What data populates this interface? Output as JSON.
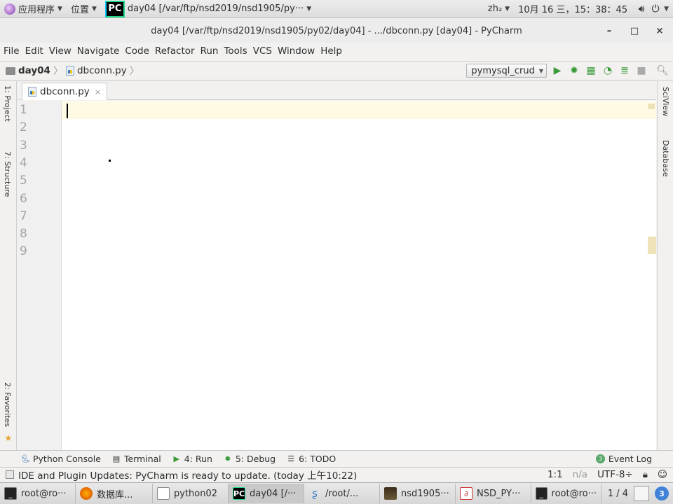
{
  "top_panel": {
    "apps_menu": "应用程序",
    "places_menu": "位置",
    "task_title": "day04 [/var/ftp/nsd2019/nsd1905/py···",
    "input_method": "zh₂",
    "datetime": "10月 16 三，15：38：45",
    "pycharm_badge": "PC"
  },
  "window": {
    "title": "day04 [/var/ftp/nsd2019/nsd1905/py02/day04] - .../dbconn.py [day04] - PyCharm",
    "minimize": "–",
    "maximize": "□",
    "close": "×"
  },
  "menu": [
    "File",
    "Edit",
    "View",
    "Navigate",
    "Code",
    "Refactor",
    "Run",
    "Tools",
    "VCS",
    "Window",
    "Help"
  ],
  "navbar": {
    "project": "day04",
    "file": "dbconn.py",
    "run_config": "pymysql_crud"
  },
  "left_tabs": {
    "project": "1: Project",
    "structure": "7: Structure",
    "favorites": "2: Favorites"
  },
  "right_tabs": {
    "sciview": "SciView",
    "database": "Database"
  },
  "editor": {
    "tab_name": "dbconn.py",
    "line_numbers": [
      "1",
      "2",
      "3",
      "4",
      "5",
      "6",
      "7",
      "8",
      "9"
    ]
  },
  "tool_windows": {
    "python_console": "Python Console",
    "terminal": "Terminal",
    "run": "4: Run",
    "debug": "5: Debug",
    "todo": "6: TODO",
    "event_log": "Event Log",
    "event_count": "3"
  },
  "status": {
    "message": "IDE and Plugin Updates: PyCharm is ready to update. (today 上午10:22)",
    "position": "1:1",
    "line_sep": "n/a",
    "encoding": "UTF-8÷"
  },
  "taskbar": {
    "items": [
      {
        "label": "root@ro···",
        "icon": "terminal-icon"
      },
      {
        "label": "数据库...",
        "icon": "firefox-icon"
      },
      {
        "label": "python02",
        "icon": "document-icon"
      },
      {
        "label": "day04 [/···",
        "icon": "pycharm-icon"
      },
      {
        "label": "/root/...",
        "icon": "file-manager-icon"
      },
      {
        "label": "nsd1905···",
        "icon": "image-icon"
      },
      {
        "label": "NSD_PY···",
        "icon": "pdf-icon"
      },
      {
        "label": "root@ro···",
        "icon": "terminal-icon"
      }
    ],
    "pager": "1 / 4",
    "notifications": "3"
  }
}
